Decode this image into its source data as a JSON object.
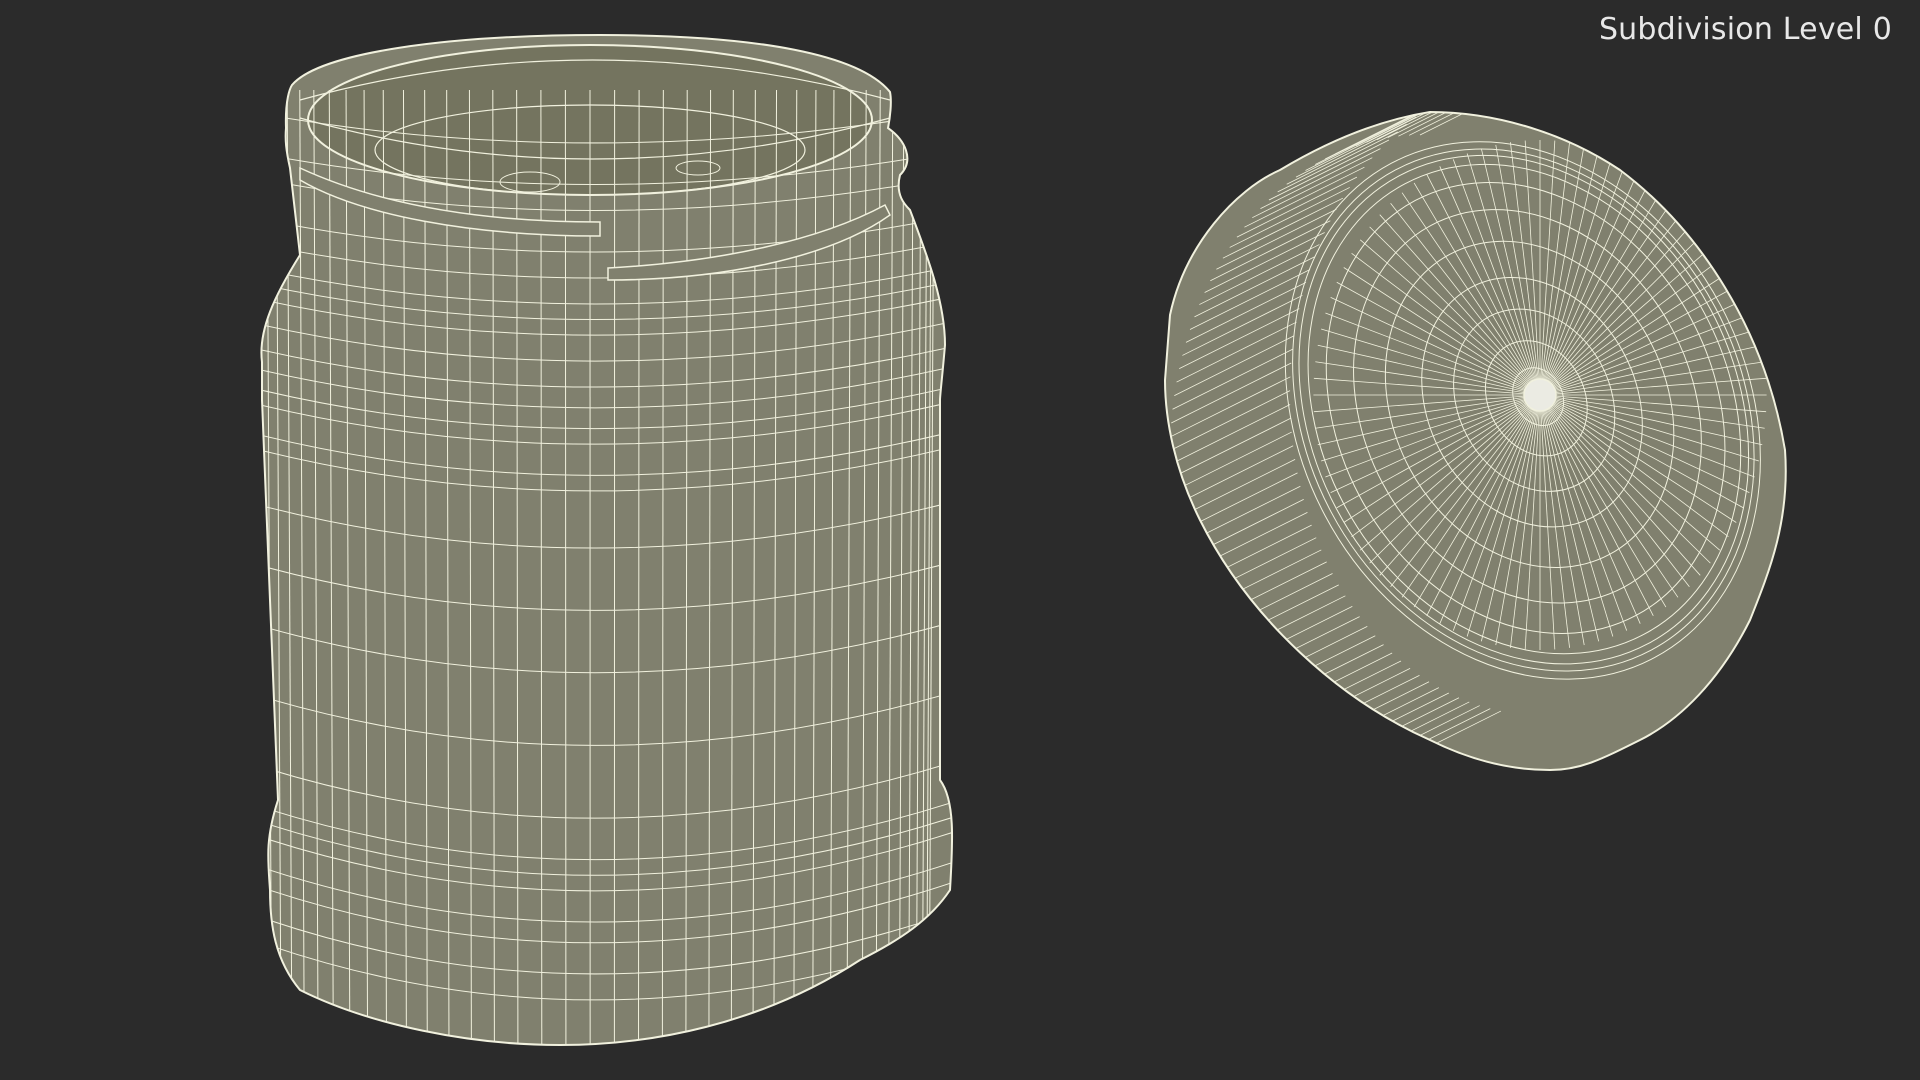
{
  "viewport": {
    "subdivision_label": "Subdivision Level 0",
    "background_color": "#2b2b2b"
  },
  "scene": {
    "objects": [
      {
        "name": "jar",
        "display": "wireframe-on-shaded"
      },
      {
        "name": "lid",
        "display": "wireframe-on-shaded"
      }
    ],
    "shading_color": "#80806e",
    "wire_color": "#f1f1de"
  }
}
